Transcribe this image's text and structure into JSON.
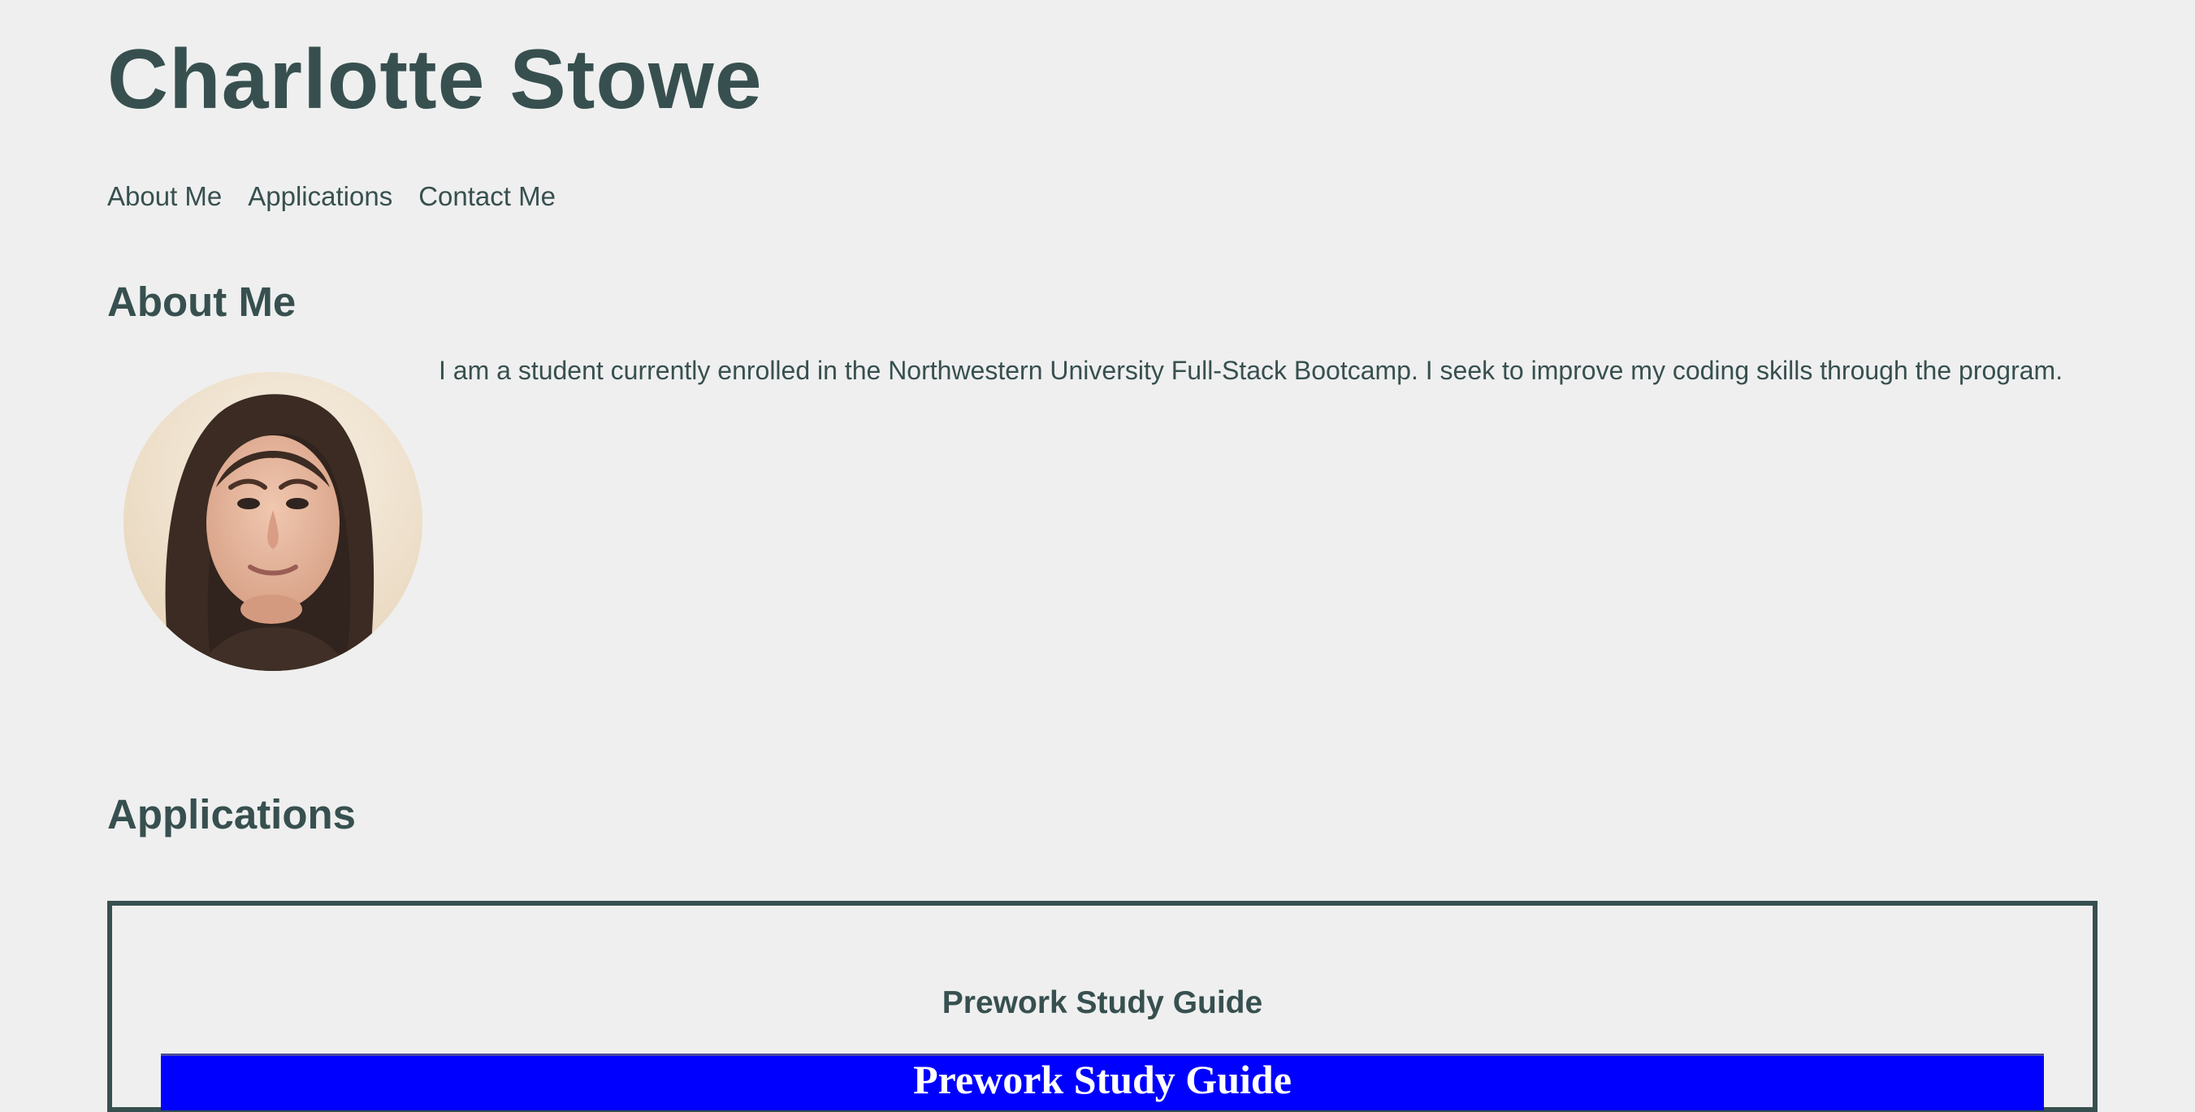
{
  "header": {
    "title": "Charlotte Stowe"
  },
  "nav": {
    "items": [
      "About Me",
      "Applications",
      "Contact Me"
    ]
  },
  "about": {
    "title": "About Me",
    "description": "I am a student currently enrolled in the Northwestern University Full-Stack Bootcamp. I seek to improve my coding skills through the program."
  },
  "applications": {
    "title": "Applications",
    "projects": [
      {
        "title": "Prework Study Guide",
        "preview_title": "Prework Study Guide"
      }
    ]
  },
  "colors": {
    "background": "#efefef",
    "text": "#37504f",
    "preview_background": "#0000ff",
    "preview_text": "#ffffff"
  }
}
